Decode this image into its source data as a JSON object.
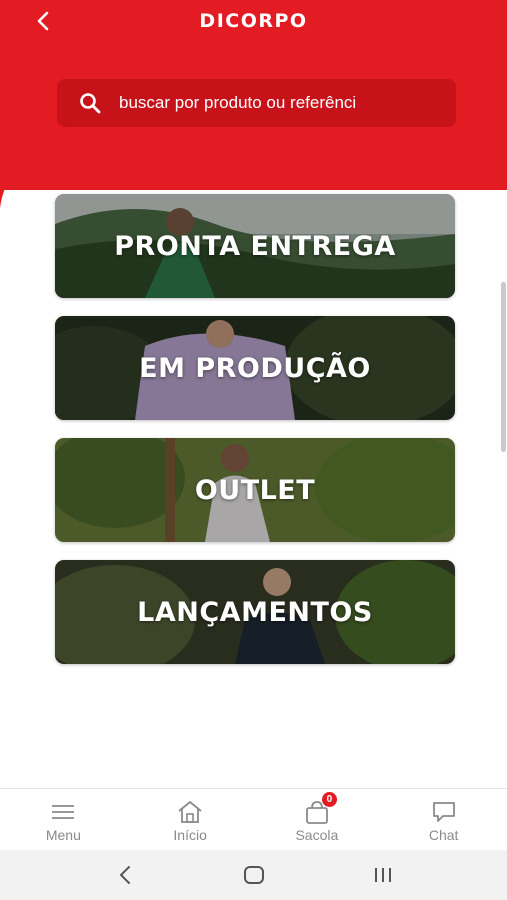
{
  "header": {
    "logo_text": "DICORPO",
    "back_icon": "chevron-left-icon",
    "brand_color": "#e31b23"
  },
  "search": {
    "placeholder": "buscar por produto ou referênci",
    "icon": "search-icon"
  },
  "categories": [
    {
      "label": "PRONTA ENTREGA"
    },
    {
      "label": "EM PRODUÇÃO"
    },
    {
      "label": "OUTLET"
    },
    {
      "label": "LANÇAMENTOS"
    }
  ],
  "bottom_nav": {
    "items": [
      {
        "label": "Menu",
        "icon": "hamburger-menu-icon"
      },
      {
        "label": "Início",
        "icon": "home-icon"
      },
      {
        "label": "Sacola",
        "icon": "shopping-bag-icon",
        "badge": "0"
      },
      {
        "label": "Chat",
        "icon": "chat-bubble-icon"
      }
    ]
  },
  "system_nav": {
    "buttons": [
      "back-icon",
      "home-circle-icon",
      "recent-apps-icon"
    ]
  }
}
